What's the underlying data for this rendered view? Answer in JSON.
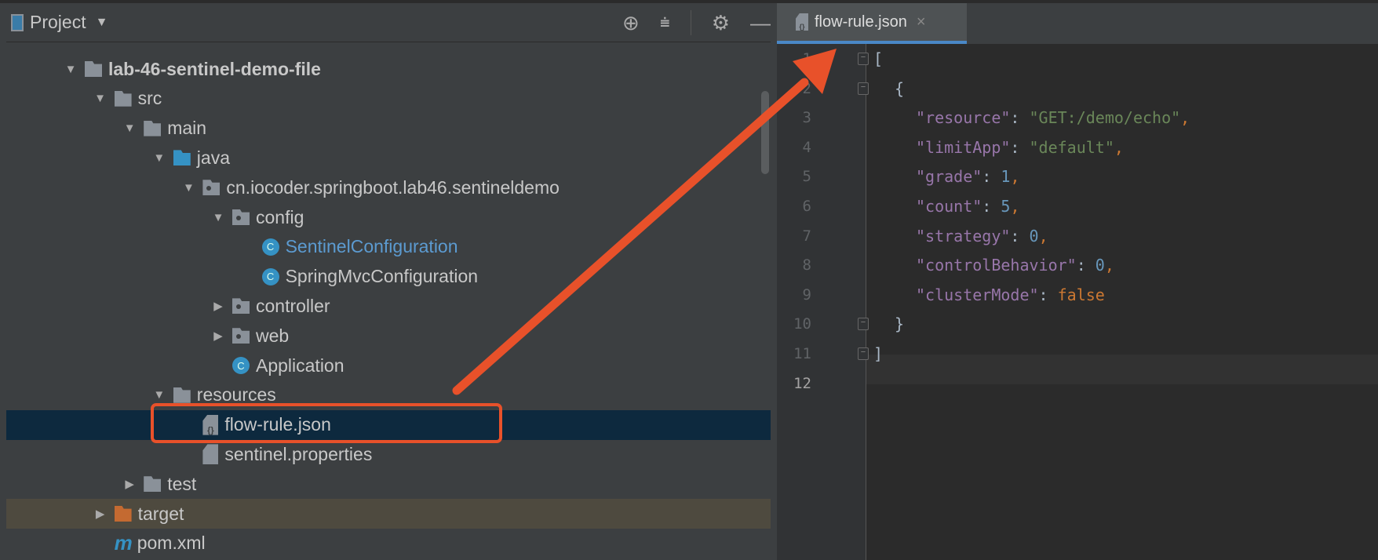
{
  "project_panel": {
    "title": "Project",
    "icons": [
      "locate-icon",
      "collapse-all-icon",
      "gear-icon",
      "minimize-icon"
    ],
    "tree": [
      {
        "label": "lab-46-sentinel-demo-file",
        "icon": "module-folder",
        "expanded": true
      },
      {
        "label": "src",
        "icon": "folder",
        "expanded": true
      },
      {
        "label": "main",
        "icon": "folder",
        "expanded": true
      },
      {
        "label": "java",
        "icon": "source-folder",
        "expanded": true
      },
      {
        "label": "cn.iocoder.springboot.lab46.sentineldemo",
        "icon": "package",
        "expanded": true
      },
      {
        "label": "config",
        "icon": "package",
        "expanded": true
      },
      {
        "label": "SentinelConfiguration",
        "icon": "class"
      },
      {
        "label": "SpringMvcConfiguration",
        "icon": "class"
      },
      {
        "label": "controller",
        "icon": "package",
        "expanded": false
      },
      {
        "label": "web",
        "icon": "package",
        "expanded": false
      },
      {
        "label": "Application",
        "icon": "spring-boot-class"
      },
      {
        "label": "resources",
        "icon": "resources-folder",
        "expanded": true
      },
      {
        "label": "flow-rule.json",
        "icon": "json-file",
        "selected": true
      },
      {
        "label": "sentinel.properties",
        "icon": "properties-file"
      },
      {
        "label": "test",
        "icon": "folder",
        "expanded": false
      },
      {
        "label": "target",
        "icon": "excluded-folder",
        "expanded": false
      },
      {
        "label": "pom.xml",
        "icon": "maven-file"
      }
    ]
  },
  "editor": {
    "tab": {
      "label": "flow-rule.json",
      "close": "×"
    },
    "current_line": 12,
    "lines": [
      "1",
      "2",
      "3",
      "4",
      "5",
      "6",
      "7",
      "8",
      "9",
      "10",
      "11",
      "12"
    ],
    "code": {
      "open_bracket": "[",
      "open_brace": "{",
      "entries": [
        {
          "key": "\"resource\"",
          "value": "\"GET:/demo/echo\"",
          "type": "string",
          "comma": ","
        },
        {
          "key": "\"limitApp\"",
          "value": "\"default\"",
          "type": "string",
          "comma": ","
        },
        {
          "key": "\"grade\"",
          "value": "1",
          "type": "number",
          "comma": ","
        },
        {
          "key": "\"count\"",
          "value": "5",
          "type": "number",
          "comma": ","
        },
        {
          "key": "\"strategy\"",
          "value": "0",
          "type": "number",
          "comma": ","
        },
        {
          "key": "\"controlBehavior\"",
          "value": "0",
          "type": "number",
          "comma": ","
        },
        {
          "key": "\"clusterMode\"",
          "value": "false",
          "type": "keyword",
          "comma": ""
        }
      ],
      "close_brace": "}",
      "close_bracket": "]",
      "colon": ": "
    }
  },
  "annotation_color": "#e8512a"
}
